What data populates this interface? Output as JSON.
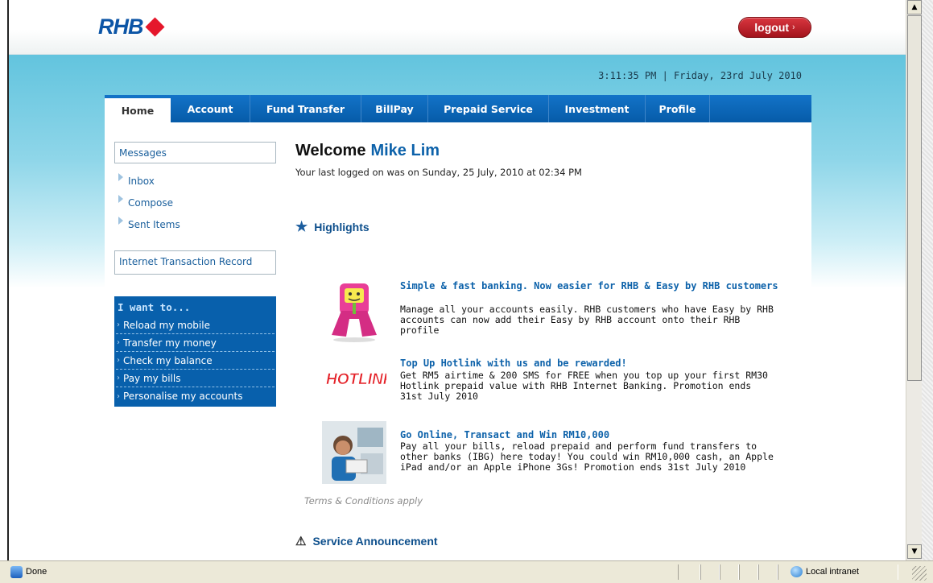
{
  "header": {
    "logo_text": "RHB",
    "logout_label": "logout",
    "logout_arrow": "›",
    "datetime": "3:11:35 PM | Friday, 23rd July 2010"
  },
  "tabs": [
    {
      "label": "Home"
    },
    {
      "label": "Account"
    },
    {
      "label": "Fund Transfer"
    },
    {
      "label": "BillPay"
    },
    {
      "label": "Prepaid Service"
    },
    {
      "label": "Investment"
    },
    {
      "label": "Profile"
    }
  ],
  "sidebar": {
    "messages_label": "Messages",
    "links": [
      "Inbox",
      "Compose",
      "Sent Items"
    ],
    "transaction_record_label": "Internet Transaction Record",
    "iwant_title": "I want to...",
    "iwant_items": [
      "Reload my mobile",
      "Transfer my money",
      "Check my balance",
      "Pay my bills",
      "Personalise my accounts"
    ]
  },
  "main": {
    "welcome_label": "Welcome",
    "user_name": "Mike Lim",
    "last_login": "Your last logged on was on  Sunday, 25 July, 2010 at 02:34 PM",
    "highlights_label": "Highlights",
    "promos": [
      {
        "title": "Simple & fast banking. Now easier for RHB & Easy by RHB customers",
        "body": "Manage all your accounts easily. RHB customers who have Easy by RHB accounts can now add their Easy by RHB account onto their RHB profile"
      },
      {
        "title": "Top Up Hotlink with us and be rewarded!",
        "body": "Get RM5 airtime & 200 SMS for FREE when you top up your first RM30 Hotlink prepaid value with RHB Internet Banking. Promotion ends 31st July 2010",
        "logo_text": "HOTLINK"
      },
      {
        "title": "Go Online, Transact and Win RM10,000",
        "body": "Pay all your bills, reload prepaid and perform fund transfers to other banks (IBG) here today! You could win RM10,000 cash, an Apple iPad and/or an Apple iPhone 3Gs! Promotion ends 31st July 2010"
      }
    ],
    "terms": "Terms & Conditions apply",
    "service_announcement_label": "Service Announcement"
  },
  "statusbar": {
    "status": "Done",
    "zone": "Local intranet"
  },
  "colors": {
    "brand_blue": "#0c55a6",
    "brand_red": "#e5172b",
    "tab_blue": "#065ba8",
    "band_cyan": "#62c4de"
  }
}
